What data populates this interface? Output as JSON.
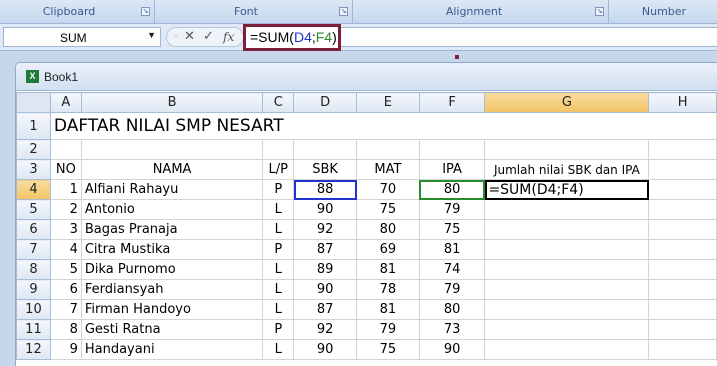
{
  "ribbon": {
    "groups": [
      "Clipboard",
      "Font",
      "Alignment",
      "Number"
    ]
  },
  "formula_bar": {
    "name_box": "SUM",
    "formula_prefix": "=SUM(",
    "ref1": "D4",
    "sep": ";",
    "ref2": "F4",
    "formula_suffix": ")",
    "ref1_color": "#2233cc",
    "ref2_color": "#2b8a2b",
    "highlight_color": "#7b1f3a"
  },
  "workbook": {
    "title": "Book1"
  },
  "sheet": {
    "columns": [
      "A",
      "B",
      "C",
      "D",
      "E",
      "F",
      "G",
      "H"
    ],
    "selected_column": "G",
    "selected_row": "4",
    "title": "DAFTAR NILAI SMP NESART",
    "headers": {
      "no": "NO",
      "nama": "NAMA",
      "lp": "L/P",
      "sbk": "SBK",
      "mat": "MAT",
      "ipa": "IPA",
      "jumlah": "Jumlah nilai SBK dan IPA"
    },
    "active_cell_text": "=SUM(D4;F4)",
    "rows": [
      {
        "row": "4",
        "no": "1",
        "nama": "Alfiani Rahayu",
        "lp": "P",
        "sbk": "88",
        "mat": "70",
        "ipa": "80"
      },
      {
        "row": "5",
        "no": "2",
        "nama": "Antonio",
        "lp": "L",
        "sbk": "90",
        "mat": "75",
        "ipa": "79"
      },
      {
        "row": "6",
        "no": "3",
        "nama": "Bagas Pranaja",
        "lp": "L",
        "sbk": "92",
        "mat": "80",
        "ipa": "75"
      },
      {
        "row": "7",
        "no": "4",
        "nama": "Citra Mustika",
        "lp": "P",
        "sbk": "87",
        "mat": "69",
        "ipa": "81"
      },
      {
        "row": "8",
        "no": "5",
        "nama": "Dika Purnomo",
        "lp": "L",
        "sbk": "89",
        "mat": "81",
        "ipa": "74"
      },
      {
        "row": "9",
        "no": "6",
        "nama": "Ferdiansyah",
        "lp": "L",
        "sbk": "90",
        "mat": "78",
        "ipa": "79"
      },
      {
        "row": "10",
        "no": "7",
        "nama": "Firman Handoyo",
        "lp": "L",
        "sbk": "87",
        "mat": "81",
        "ipa": "80"
      },
      {
        "row": "11",
        "no": "8",
        "nama": "Gesti Ratna",
        "lp": "P",
        "sbk": "92",
        "mat": "79",
        "ipa": "73"
      },
      {
        "row": "12",
        "no": "9",
        "nama": "Handayani",
        "lp": "L",
        "sbk": "90",
        "mat": "75",
        "ipa": "90"
      }
    ]
  }
}
